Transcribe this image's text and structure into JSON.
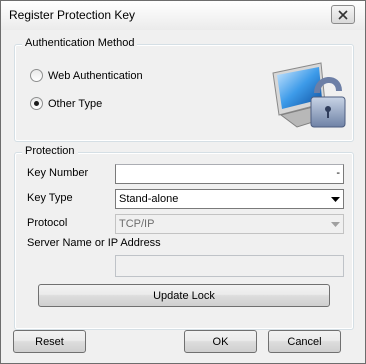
{
  "window": {
    "title": "Register Protection Key"
  },
  "auth_group": {
    "label": "Authentication Method",
    "options": [
      {
        "label": "Web Authentication",
        "checked": false
      },
      {
        "label": "Other Type",
        "checked": true
      }
    ],
    "image_icon": "network-lock-icon"
  },
  "protection_group": {
    "label": "Protection",
    "key_number": {
      "label": "Key Number",
      "value": "-"
    },
    "key_type": {
      "label": "Key Type",
      "value": "Stand-alone"
    },
    "protocol": {
      "label": "Protocol",
      "value": "TCP/IP"
    },
    "server": {
      "label": "Server Name or IP Address",
      "value": ""
    },
    "update_button": "Update Lock"
  },
  "buttons": {
    "reset": "Reset",
    "ok": "OK",
    "cancel": "Cancel"
  }
}
